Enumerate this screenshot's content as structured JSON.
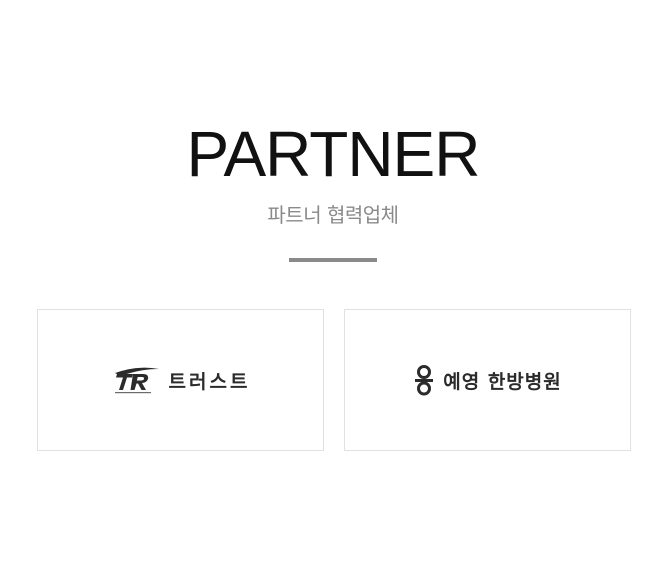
{
  "section": {
    "title": "PARTNER",
    "subtitle": "파트너 협력업체"
  },
  "partners": [
    {
      "name": "트러스트",
      "logo_icon": "tr-logo-icon"
    },
    {
      "name": "예영 한방병원",
      "logo_icon": "yeyoung-logo-icon"
    }
  ],
  "colors": {
    "title": "#111111",
    "subtitle": "#8a8a8a",
    "divider": "#8a8a8a",
    "card_border": "#e1e1e1",
    "logo_text": "#2b2b2b"
  }
}
